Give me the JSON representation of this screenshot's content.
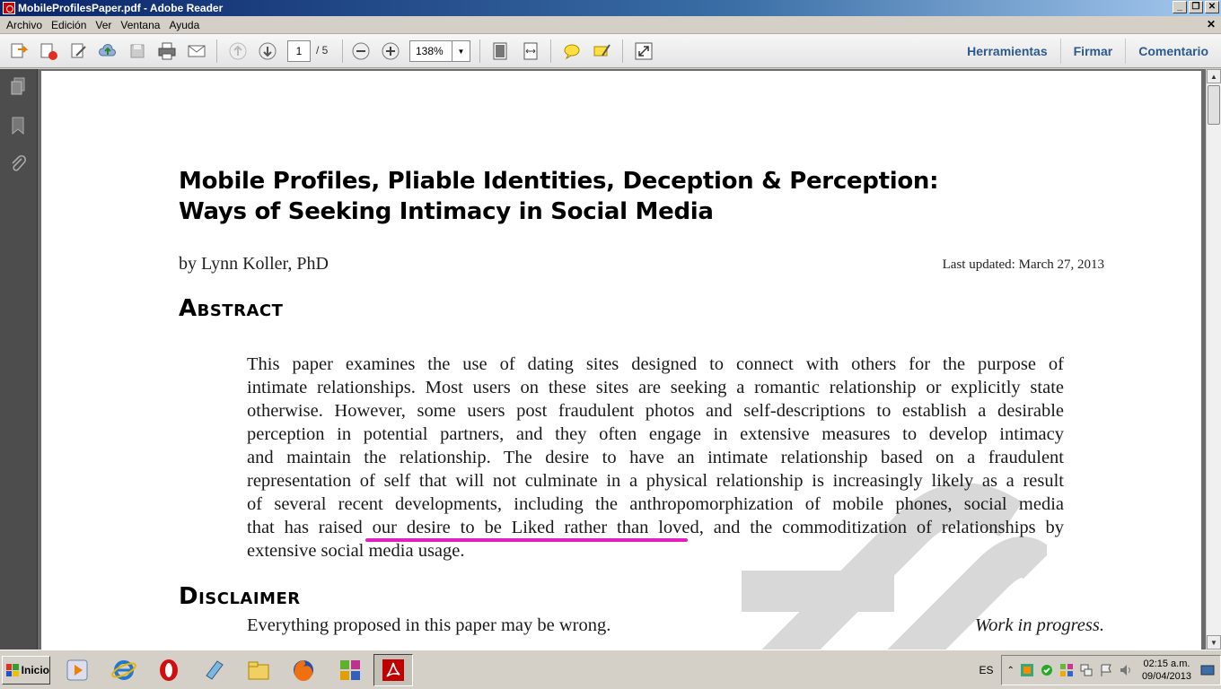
{
  "window": {
    "title": "MobileProfilesPaper.pdf - Adobe Reader",
    "minimize": "_",
    "restore": "❐",
    "close": "✕"
  },
  "menu": {
    "items": [
      "Archivo",
      "Edición",
      "Ver",
      "Ventana",
      "Ayuda"
    ],
    "close": "✕"
  },
  "toolbar": {
    "page_current": "1",
    "page_total": "/ 5",
    "zoom": "138%",
    "links": [
      "Herramientas",
      "Firmar",
      "Comentario"
    ]
  },
  "document": {
    "title_line1": "Mobile Profiles, Pliable Identities, Deception & Perception:",
    "title_line2": "Ways of Seeking Intimacy in Social Media",
    "author": "by Lynn Koller, PhD",
    "updated": "Last updated: March 27, 2013",
    "abstract_heading": "Abstract",
    "abstract_lines": [
      "This paper examines the use of dating sites designed to connect with others for the purpose of",
      "intimate relationships. Most users on these sites are seeking a romantic relationship or explicitly state",
      "otherwise. However, some users post fraudulent photos and self-descriptions to establish a desirable",
      "perception in potential partners, and they often engage in extensive measures to develop intimacy",
      "and maintain the relationship. The desire to have an intimate relationship based on a fraudulent",
      "representation of self that will not culminate in a physical relationship is increasingly likely as a result",
      "of several recent developments, including the anthropomorphization of mobile phones, social media",
      "that has raised our desire to be Liked rather than loved, and the commoditization of relationships by",
      "extensive social media usage."
    ],
    "disclaimer_heading": "Disclaimer",
    "disclaimer_text": "Everything proposed in this paper may be wrong.",
    "disclaimer_note": "Work in progress."
  },
  "taskbar": {
    "start_label": "Inicio",
    "language": "ES",
    "time": "02:15 a.m.",
    "date": "09/04/2013"
  },
  "colors": {
    "highlight_underline": "#e020c0",
    "link_color": "#2c5a8c"
  }
}
